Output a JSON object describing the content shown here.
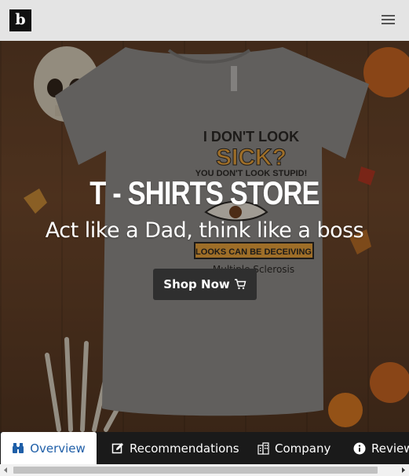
{
  "header": {
    "logo_letter": "b",
    "menu_icon": "hamburger-menu-icon"
  },
  "hero": {
    "title": "T - SHIRTS STORE",
    "subtitle": "Act like a Dad, think like a boss",
    "cta_label": "Shop Now",
    "cta_icon": "cart-icon",
    "shirt_print": {
      "line1": "I DON'T LOOK",
      "line2": "SICK?",
      "line3": "YOU DON'T LOOK STUPID!",
      "line4": "LOOKS CAN BE DECEIVING",
      "line5": "Multiple Sclerosis"
    }
  },
  "tabs": [
    {
      "label": "Overview",
      "icon": "binoculars-icon",
      "active": true
    },
    {
      "label": "Recommendations",
      "icon": "edit-icon",
      "active": false
    },
    {
      "label": "Company",
      "icon": "building-icon",
      "active": false
    },
    {
      "label": "Review",
      "icon": "info-icon",
      "active": false
    }
  ],
  "colors": {
    "topbar": "#e4e4e4",
    "tabbar": "#1a1a1a",
    "active_tab_text": "#1f5fa8",
    "print_orange": "#e8a23a"
  }
}
